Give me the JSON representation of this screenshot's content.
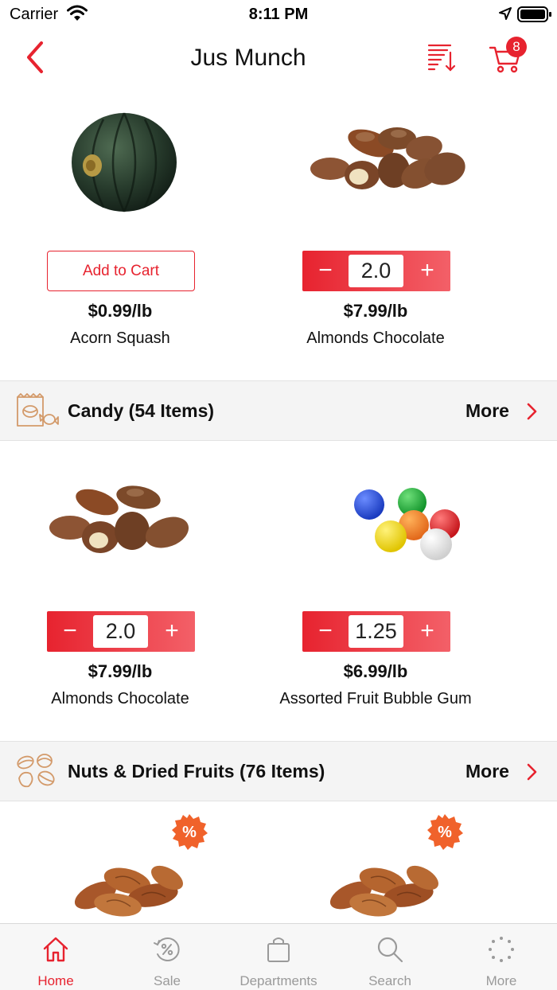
{
  "status_bar": {
    "carrier": "Carrier",
    "time": "8:11 PM"
  },
  "nav": {
    "title": "Jus Munch",
    "cart_count": "8"
  },
  "top_products": [
    {
      "name": "Acorn Squash",
      "price": "$0.99/lb",
      "image": "acorn-squash-image",
      "action": "add",
      "add_label": "Add to Cart"
    },
    {
      "name": "Almonds Chocolate",
      "price": "$7.99/lb",
      "image": "chocolate-almonds-image",
      "action": "stepper",
      "quantity": "2.0"
    }
  ],
  "sections": [
    {
      "title": "Candy (54 Items)",
      "more_label": "More",
      "icon": "candy-icon",
      "products": [
        {
          "name": "Almonds Chocolate",
          "price": "$7.99/lb",
          "image": "chocolate-almonds-image",
          "quantity": "2.0"
        },
        {
          "name": "Assorted Fruit Bubble Gum",
          "price": "$6.99/lb",
          "image": "bubble-gum-image",
          "quantity": "1.25"
        }
      ]
    },
    {
      "title": "Nuts & Dried Fruits (76 Items)",
      "more_label": "More",
      "icon": "nuts-icon",
      "products": [
        {
          "image": "pecans-image",
          "sale_badge": "%"
        },
        {
          "image": "pecans-image",
          "sale_badge": "%"
        }
      ]
    }
  ],
  "stepper": {
    "minus": "−",
    "plus": "+"
  },
  "tabs": [
    {
      "label": "Home",
      "icon": "home-icon",
      "active": true
    },
    {
      "label": "Sale",
      "icon": "sale-icon",
      "active": false
    },
    {
      "label": "Departments",
      "icon": "shopping-bag-icon",
      "active": false
    },
    {
      "label": "Search",
      "icon": "search-icon",
      "active": false
    },
    {
      "label": "More",
      "icon": "more-dots-icon",
      "active": false
    }
  ],
  "colors": {
    "accent": "#e7232f",
    "section_bg": "#f4f4f4",
    "tab_inactive": "#9a9a9a"
  }
}
